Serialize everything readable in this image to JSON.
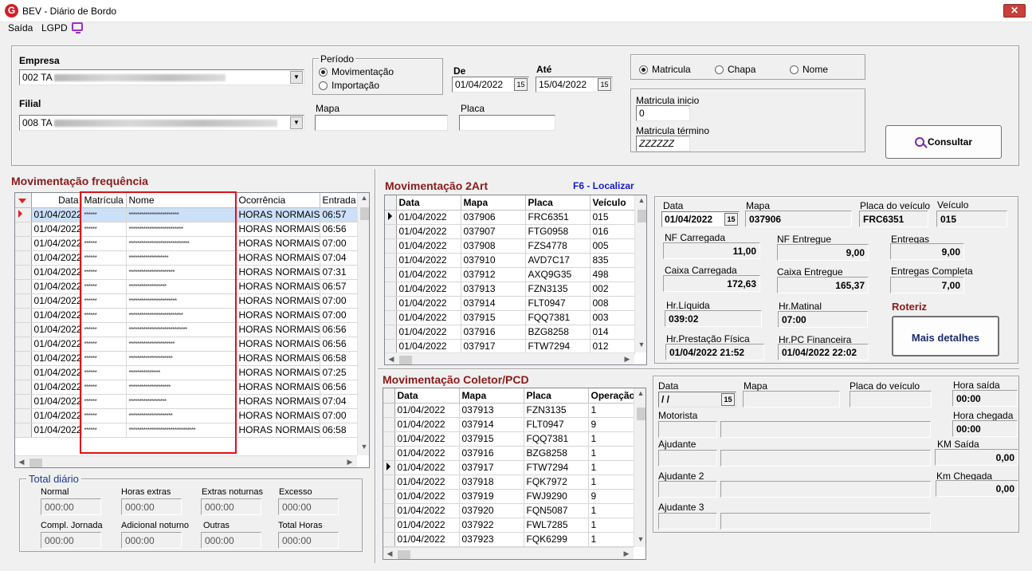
{
  "window": {
    "title": "BEV - Diário de Bordo",
    "logo_letter": "G",
    "close_glyph": "✕"
  },
  "menu": [
    {
      "label": "Saída"
    },
    {
      "label": "LGPD"
    }
  ],
  "filters": {
    "empresa_label": "Empresa",
    "empresa_value": "002 TA",
    "filial_label": "Filial",
    "filial_value": "008 TA",
    "periodo_label": "Período",
    "periodo_options": [
      "Movimentação",
      "Importação"
    ],
    "de_label": "De",
    "de_value": "01/04/2022",
    "ate_label": "Até",
    "ate_value": "15/04/2022",
    "mapa_label": "Mapa",
    "placa_label": "Placa",
    "search_options": [
      "Matricula",
      "Chapa",
      "Nome"
    ],
    "matricula_inicio_label": "Matricula inicio",
    "matricula_inicio_value": "0",
    "matricula_termino_label": "Matricula término",
    "matricula_termino_value": "ZZZZZZ",
    "consultar_label": "Consultar",
    "cal_glyph": "15"
  },
  "freq": {
    "title": "Movimentação frequência",
    "columns": [
      "Data",
      "Matrícula",
      "Nome",
      "Ocorrência",
      "Entrada"
    ],
    "rows": [
      [
        "01/04/2022",
        "******",
        "************************",
        "HORAS NORMAIS",
        "06:57"
      ],
      [
        "01/04/2022",
        "******",
        "**************************",
        "HORAS NORMAIS",
        "06:56"
      ],
      [
        "01/04/2022",
        "******",
        "*****************************",
        "HORAS NORMAIS",
        "07:00"
      ],
      [
        "01/04/2022",
        "******",
        "*******************",
        "HORAS NORMAIS",
        "07:04"
      ],
      [
        "01/04/2022",
        "******",
        "**********************",
        "HORAS NORMAIS",
        "07:31"
      ],
      [
        "01/04/2022",
        "******",
        "******************",
        "HORAS NORMAIS",
        "06:57"
      ],
      [
        "01/04/2022",
        "******",
        "***********************",
        "HORAS NORMAIS",
        "07:00"
      ],
      [
        "01/04/2022",
        "******",
        "**************************",
        "HORAS NORMAIS",
        "07:00"
      ],
      [
        "01/04/2022",
        "******",
        "****************************",
        "HORAS NORMAIS",
        "06:56"
      ],
      [
        "01/04/2022",
        "******",
        "**********************",
        "HORAS NORMAIS",
        "06:56"
      ],
      [
        "01/04/2022",
        "******",
        "*********************",
        "HORAS NORMAIS",
        "06:58"
      ],
      [
        "01/04/2022",
        "******",
        "***************",
        "HORAS NORMAIS",
        "07:25"
      ],
      [
        "01/04/2022",
        "******",
        "********************",
        "HORAS NORMAIS",
        "06:56"
      ],
      [
        "01/04/2022",
        "******",
        "******************",
        "HORAS NORMAIS",
        "07:04"
      ],
      [
        "01/04/2022",
        "******",
        "*********************",
        "HORAS NORMAIS",
        "07:00"
      ],
      [
        "01/04/2022",
        "******",
        "********************************",
        "HORAS NORMAIS",
        "06:58"
      ]
    ]
  },
  "totals": {
    "title": "Total diário",
    "items": [
      {
        "label": "Normal",
        "value": "000:00"
      },
      {
        "label": "Horas extras",
        "value": "000:00"
      },
      {
        "label": "Extras noturnas",
        "value": "000:00"
      },
      {
        "label": "Excesso",
        "value": "000:00"
      },
      {
        "label": "Compl. Jornada",
        "value": "000:00"
      },
      {
        "label": "Adicional noturno",
        "value": "000:00"
      },
      {
        "label": "Outras",
        "value": "000:00"
      },
      {
        "label": "Total Horas",
        "value": "000:00"
      }
    ]
  },
  "art": {
    "title": "Movimentação 2Art",
    "shortcut": "F6 - Localizar",
    "columns": [
      "Data",
      "Mapa",
      "Placa",
      "Veículo"
    ],
    "rows": [
      [
        "01/04/2022",
        "037906",
        "FRC6351",
        "015"
      ],
      [
        "01/04/2022",
        "037907",
        "FTG0958",
        "016"
      ],
      [
        "01/04/2022",
        "037908",
        "FZS4778",
        "005"
      ],
      [
        "01/04/2022",
        "037910",
        "AVD7C17",
        "835"
      ],
      [
        "01/04/2022",
        "037912",
        "AXQ9G35",
        "498"
      ],
      [
        "01/04/2022",
        "037913",
        "FZN3135",
        "002"
      ],
      [
        "01/04/2022",
        "037914",
        "FLT0947",
        "008"
      ],
      [
        "01/04/2022",
        "037915",
        "FQQ7381",
        "003"
      ],
      [
        "01/04/2022",
        "037916",
        "BZG8258",
        "014"
      ],
      [
        "01/04/2022",
        "037917",
        "FTW7294",
        "012"
      ]
    ]
  },
  "art_detail": {
    "data_label": "Data",
    "data_value": "01/04/2022",
    "mapa_label": "Mapa",
    "mapa_value": "037906",
    "placa_label": "Placa do veículo",
    "placa_value": "FRC6351",
    "veiculo_label": "Veículo",
    "veiculo_value": "015",
    "nf_carregada_label": "NF Carregada",
    "nf_carregada_value": "11,00",
    "nf_entregue_label": "NF Entregue",
    "nf_entregue_value": "9,00",
    "entregas_label": "Entregas",
    "entregas_value": "9,00",
    "caixa_carregada_label": "Caixa Carregada",
    "caixa_carregada_value": "172,63",
    "caixa_entregue_label": "Caixa Entregue",
    "caixa_entregue_value": "165,37",
    "entregas_completa_label": "Entregas Completa",
    "entregas_completa_value": "7,00",
    "hr_liquida_label": "Hr.Líquida",
    "hr_liquida_value": "039:02",
    "hr_matinal_label": "Hr.Matinal",
    "hr_matinal_value": "07:00",
    "roteriz_label": "Roteriz",
    "hr_prestacao_label": "Hr.Prestação Física",
    "hr_prestacao_value": "01/04/2022 21:52",
    "hr_pc_label": "Hr.PC Financeira",
    "hr_pc_value": "01/04/2022 22:02",
    "mais_detalhes_label": "Mais detalhes"
  },
  "coletor": {
    "title": "Movimentação Coletor/PCD",
    "columns": [
      "Data",
      "Mapa",
      "Placa",
      "Operação"
    ],
    "rows": [
      [
        "01/04/2022",
        "037913",
        "FZN3135",
        "1"
      ],
      [
        "01/04/2022",
        "037914",
        "FLT0947",
        "9"
      ],
      [
        "01/04/2022",
        "037915",
        "FQQ7381",
        "1"
      ],
      [
        "01/04/2022",
        "037916",
        "BZG8258",
        "1"
      ],
      [
        "01/04/2022",
        "037917",
        "FTW7294",
        "1"
      ],
      [
        "01/04/2022",
        "037918",
        "FQK7972",
        "1"
      ],
      [
        "01/04/2022",
        "037919",
        "FWJ9290",
        "9"
      ],
      [
        "01/04/2022",
        "037920",
        "FQN5087",
        "1"
      ],
      [
        "01/04/2022",
        "037922",
        "FWL7285",
        "1"
      ],
      [
        "01/04/2022",
        "037923",
        "FQK6299",
        "1"
      ]
    ]
  },
  "coletor_detail": {
    "data_label": "Data",
    "data_value": " /  /",
    "mapa_label": "Mapa",
    "placa_label": "Placa do veículo",
    "hora_saida_label": "Hora saída",
    "hora_saida_value": "00:00",
    "motorista_label": "Motorista",
    "hora_chegada_label": "Hora chegada",
    "hora_chegada_value": "00:00",
    "ajudante_label": "Ajudante",
    "km_saida_label": "KM Saída",
    "km_saida_value": "0,00",
    "ajudante2_label": "Ajudante 2",
    "km_chegada_label": "Km Chegada",
    "km_chegada_value": "0,00",
    "ajudante3_label": "Ajudante 3"
  }
}
